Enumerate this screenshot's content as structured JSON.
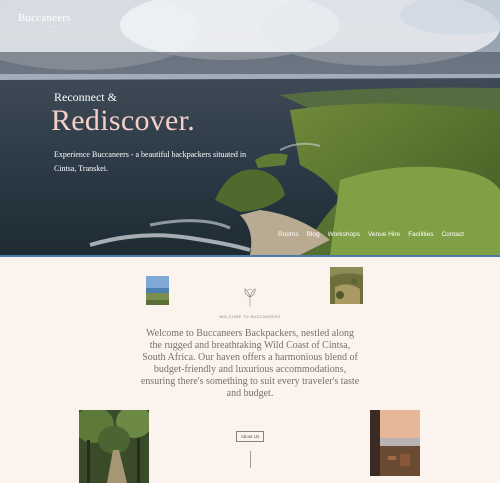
{
  "brand": {
    "name": "Buccaneers",
    "subtitle": "BACKPACKERS"
  },
  "hero": {
    "eyebrow": "Reconnect &",
    "headline": "Rediscover.",
    "description": "Experience Buccaneers - a beautiful backpackers situated in Cintsa, Transkei."
  },
  "nav": {
    "items": [
      "Rooms",
      "Blog",
      "Workshops",
      "Venue Hire",
      "Facilities",
      "Contact"
    ]
  },
  "welcome": {
    "kicker": "WELCOME TO BUCCANEERS",
    "text": "Welcome to Buccaneers Backpackers, nestled along the rugged and breathtaking Wild Coast of Cintsa, South Africa. Our haven offers a harmonious blend of budget-friendly and luxurious accommodations, ensuring there's something to suit every traveler's taste and budget.",
    "button": "About Us"
  },
  "colors": {
    "background": "#fbf4ee",
    "accent_line": "#4b79a8",
    "headline": "#f4cfc7",
    "body_text": "#7c6e66"
  }
}
